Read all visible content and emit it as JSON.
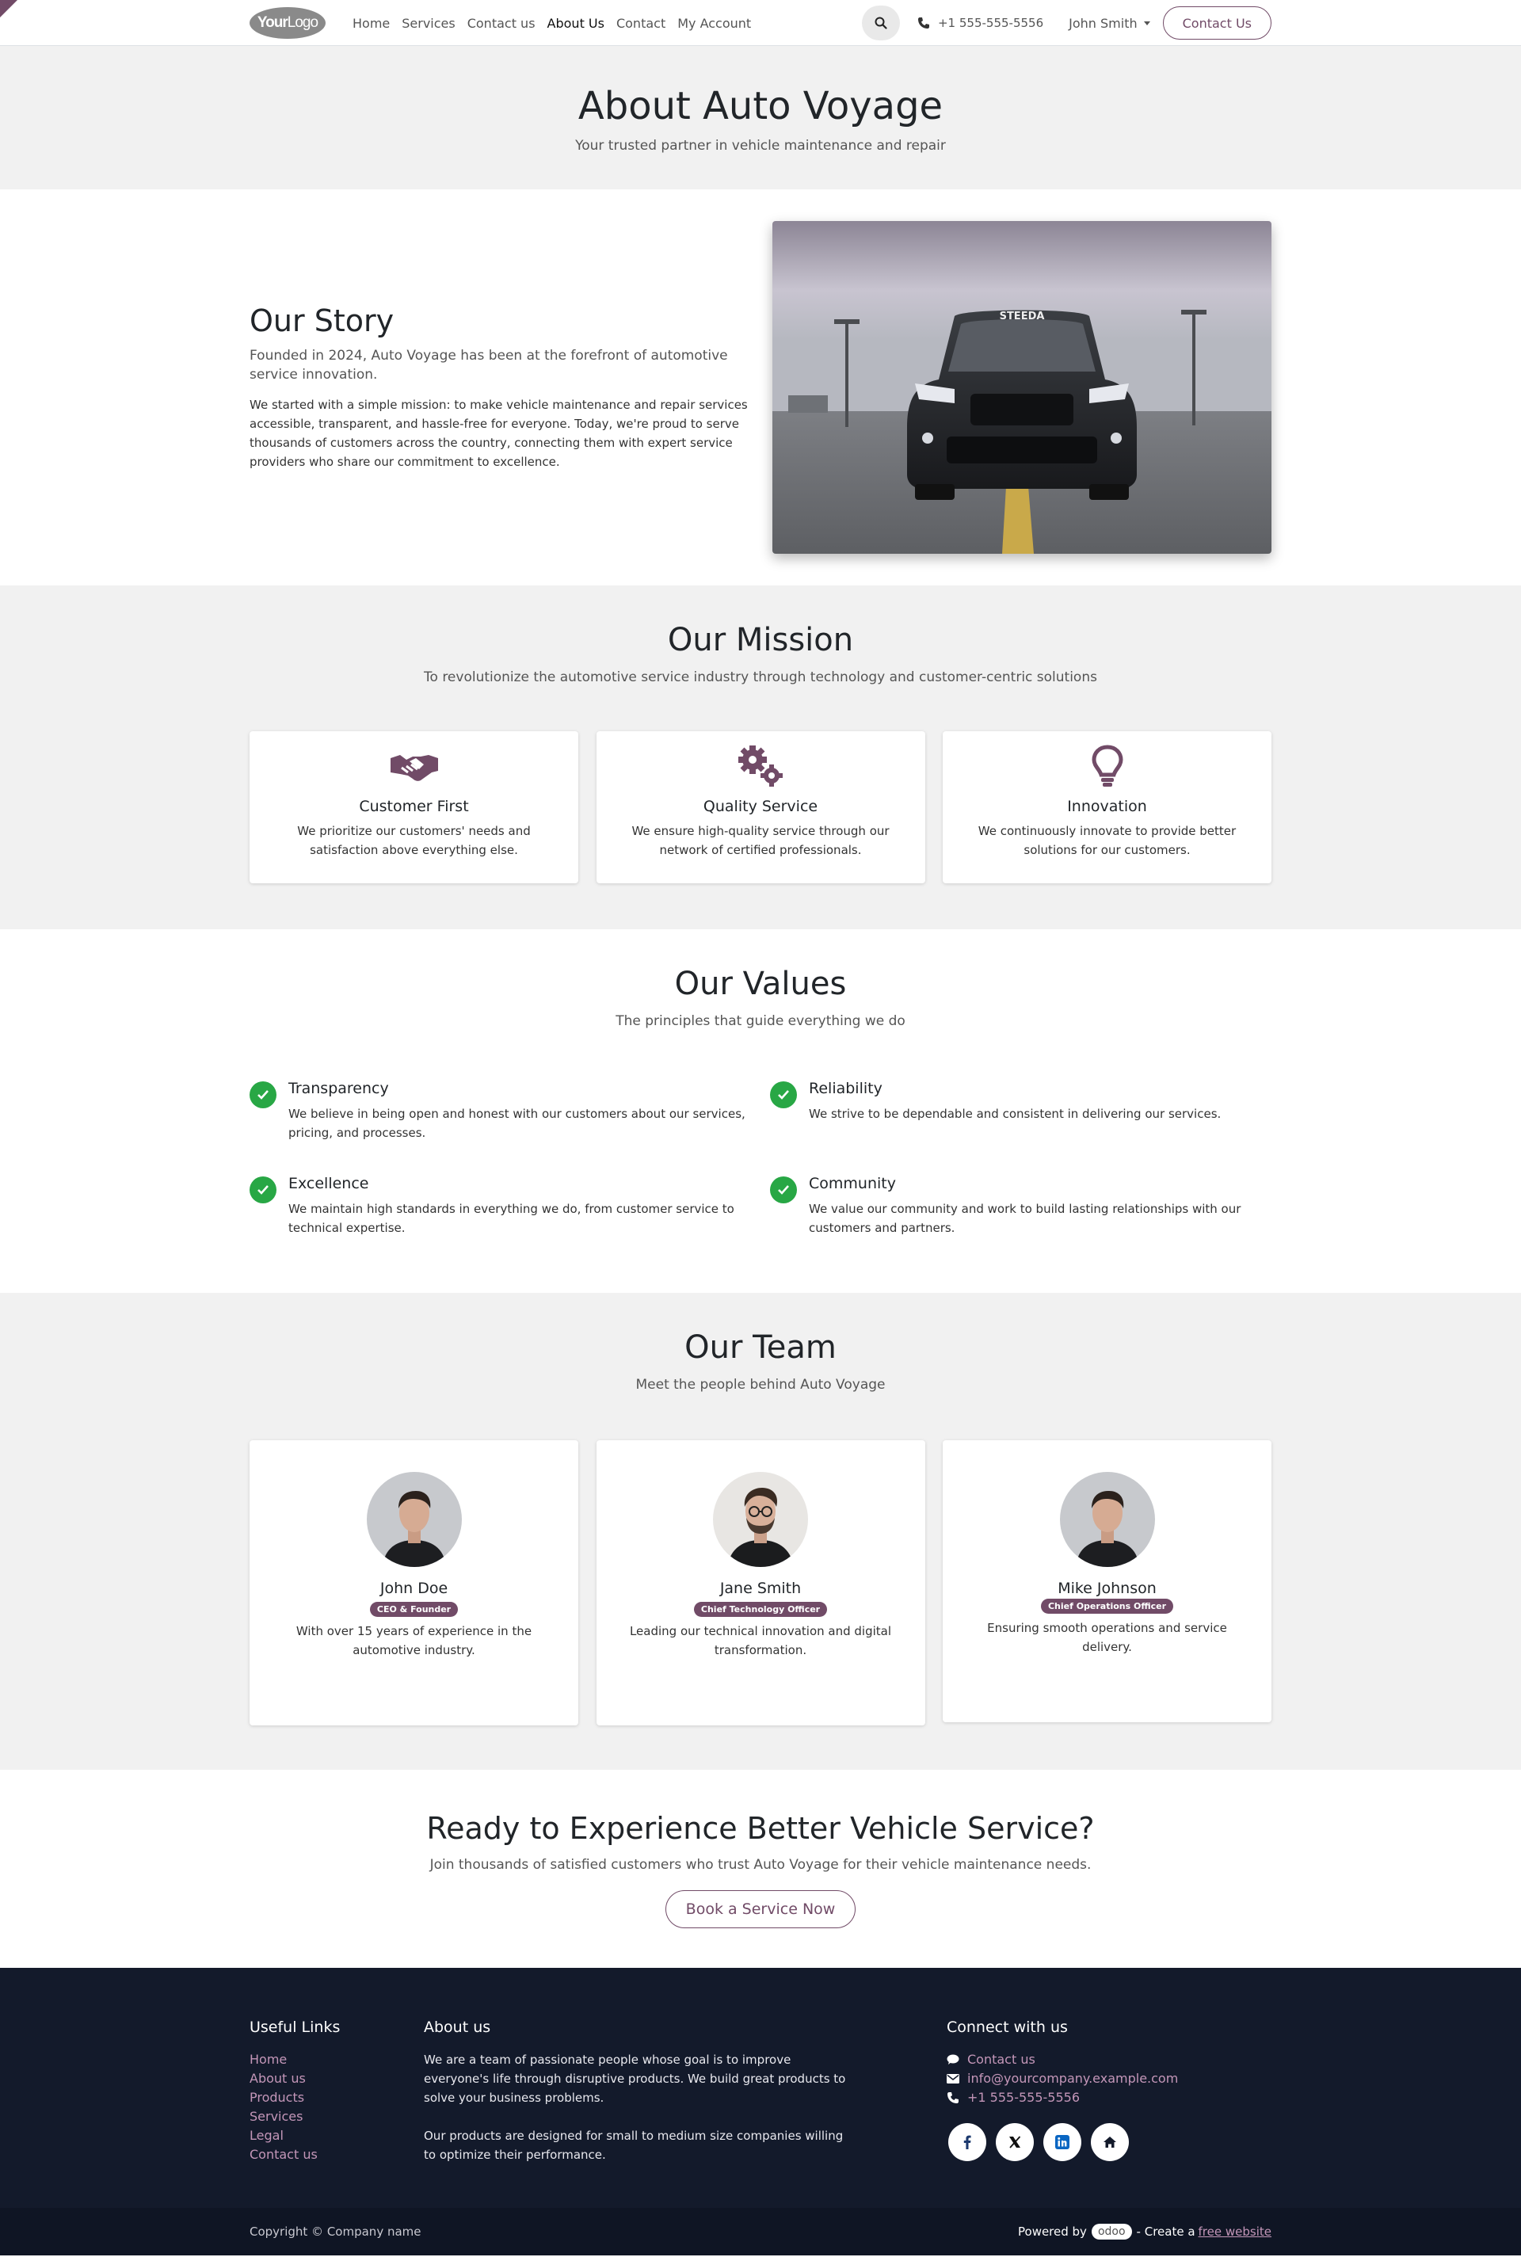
{
  "logo": {
    "bold": "Your",
    "light": "Logo"
  },
  "nav": [
    {
      "label": "Home"
    },
    {
      "label": "Services"
    },
    {
      "label": "Contact us"
    },
    {
      "label": "About Us"
    },
    {
      "label": "Contact"
    },
    {
      "label": "My Account"
    }
  ],
  "header": {
    "phone": "+1 555-555-5556",
    "user": "John Smith",
    "cta": "Contact Us"
  },
  "hero": {
    "title": "About Auto Voyage",
    "subtitle": "Your trusted partner in vehicle maintenance and repair"
  },
  "story": {
    "title": "Our Story",
    "lead": "Founded in 2024, Auto Voyage has been at the forefront of automotive service innovation.",
    "body": "We started with a simple mission: to make vehicle maintenance and repair services accessible, transparent, and hassle-free for everyone. Today, we're proud to serve thousands of customers across the country, connecting them with expert service providers who share our commitment to excellence.",
    "plate": "STEEDA"
  },
  "mission": {
    "title": "Our Mission",
    "subtitle": "To revolutionize the automotive service industry through technology and customer-centric solutions",
    "cards": [
      {
        "icon": "handshake-icon",
        "title": "Customer First",
        "text": "We prioritize our customers' needs and satisfaction above everything else."
      },
      {
        "icon": "gears-icon",
        "title": "Quality Service",
        "text": "We ensure high-quality service through our network of certified professionals."
      },
      {
        "icon": "lightbulb-icon",
        "title": "Innovation",
        "text": "We continuously innovate to provide better solutions for our customers."
      }
    ]
  },
  "values": {
    "title": "Our Values",
    "subtitle": "The principles that guide everything we do",
    "items": [
      {
        "title": "Transparency",
        "text": "We believe in being open and honest with our customers about our services, pricing, and processes."
      },
      {
        "title": "Reliability",
        "text": "We strive to be dependable and consistent in delivering our services."
      },
      {
        "title": "Excellence",
        "text": "We maintain high standards in everything we do, from customer service to technical expertise."
      },
      {
        "title": "Community",
        "text": "We value our community and work to build lasting relationships with our customers and partners."
      }
    ]
  },
  "team": {
    "title": "Our Team",
    "subtitle": "Meet the people behind Auto Voyage",
    "members": [
      {
        "name": "John Doe",
        "role": "CEO & Founder",
        "text": "With over 15 years of experience in the automotive industry."
      },
      {
        "name": "Jane Smith",
        "role": "Chief Technology Officer",
        "text": "Leading our technical innovation and digital transformation."
      },
      {
        "name": "Mike Johnson",
        "role": "Chief Operations Officer",
        "text": "Ensuring smooth operations and service delivery."
      }
    ]
  },
  "cta": {
    "title": "Ready to Experience Better Vehicle Service?",
    "subtitle": "Join thousands of satisfied customers who trust Auto Voyage for their vehicle maintenance needs.",
    "button": "Book a Service Now"
  },
  "footer": {
    "links_title": "Useful Links",
    "links": [
      "Home",
      "About us",
      "Products",
      "Services",
      "Legal",
      "Contact us"
    ],
    "about_title": "About us",
    "about_p1": "We are a team of passionate people whose goal is to improve everyone's life through disruptive products. We build great products to solve your business problems.",
    "about_p2": "Our products are designed for small to medium size companies willing to optimize their performance.",
    "connect_title": "Connect with us",
    "contact_us": "Contact us",
    "email": "info@yourcompany.example.com",
    "phone": "+1 555-555-5556",
    "socials": [
      "facebook-icon",
      "x-icon",
      "linkedin-icon",
      "home-icon"
    ],
    "copyright": "Copyright © Company name",
    "powered_by": "Powered by",
    "odoo": "odoo",
    "create_a": "- Create a",
    "free_website": "free website"
  },
  "colors": {
    "brand": "#714b67",
    "check": "#28a745",
    "footer_bg": "#131a2b",
    "footer_link": "#c396b8"
  }
}
